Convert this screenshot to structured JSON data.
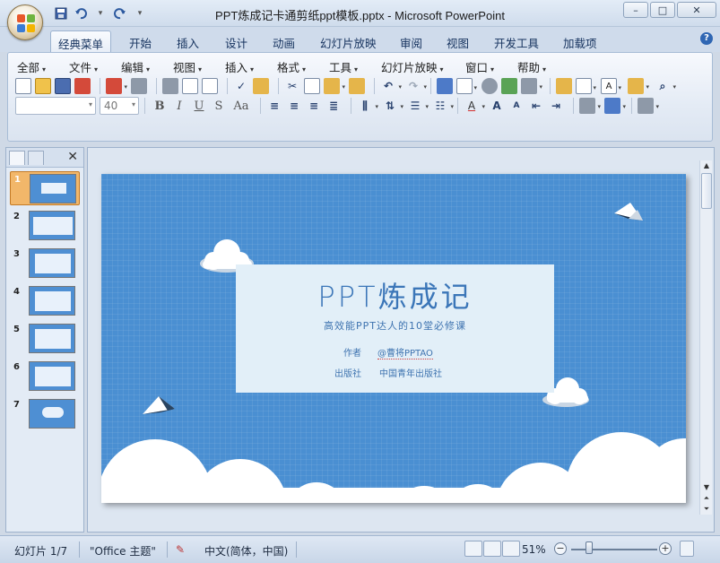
{
  "window": {
    "title": "PPT炼成记卡通剪纸ppt模板.pptx - Microsoft PowerPoint",
    "minimize": "–",
    "maximize": "□",
    "close": "✕"
  },
  "qat": {
    "save_icon": "save-icon",
    "undo_icon": "undo-icon",
    "redo_icon": "redo-icon",
    "customize": "▾"
  },
  "tabs": [
    {
      "label": "经典菜单",
      "active": true
    },
    {
      "label": "开始"
    },
    {
      "label": "插入"
    },
    {
      "label": "设计"
    },
    {
      "label": "动画"
    },
    {
      "label": "幻灯片放映"
    },
    {
      "label": "审阅"
    },
    {
      "label": "视图"
    },
    {
      "label": "开发工具"
    },
    {
      "label": "加载项"
    }
  ],
  "help": "?",
  "menus": [
    "全部",
    "文件",
    "编辑",
    "视图",
    "插入",
    "格式",
    "工具",
    "幻灯片放映",
    "窗口",
    "帮助"
  ],
  "format": {
    "font_name": "",
    "font_size": "40",
    "bold": "B",
    "italic": "I",
    "underline": "U",
    "shadow": "S",
    "case": "Aa"
  },
  "slides_panel": {
    "close": "✕",
    "slides": [
      {
        "num": "1"
      },
      {
        "num": "2"
      },
      {
        "num": "3"
      },
      {
        "num": "4"
      },
      {
        "num": "5"
      },
      {
        "num": "6"
      },
      {
        "num": "7"
      }
    ]
  },
  "slide": {
    "title": "PPT炼成记",
    "subtitle": "高效能PPT达人的10堂必修课",
    "author_label": "作者",
    "author_value": "@曹将PPTAO",
    "publisher_label": "出版社",
    "publisher_value": "中国青年出版社",
    "colors": {
      "background": "#4a8fd2",
      "card": "#e2eff8",
      "text": "#3b76b8"
    }
  },
  "status": {
    "slide_count": "幻灯片 1/7",
    "theme": "\"Office 主题\"",
    "language": "中文(简体，中国)",
    "zoom": "51%"
  }
}
